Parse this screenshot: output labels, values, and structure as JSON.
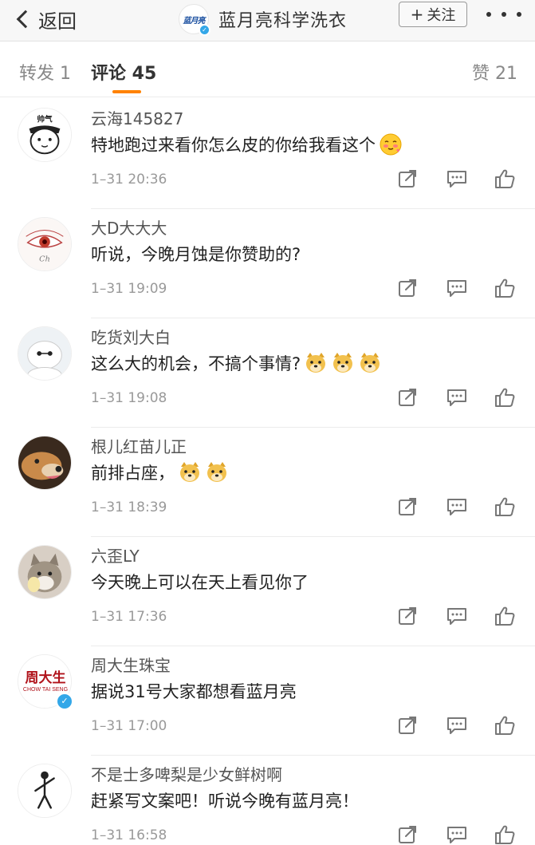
{
  "navbar": {
    "back_label": "返回",
    "logo_text": "蓝月亮",
    "account_name": "蓝月亮科学洗衣",
    "follow_label": "关注",
    "follow_plus": "+"
  },
  "tabs": {
    "repost": "转发 1",
    "comments": "评论 45",
    "likes": "赞 21"
  },
  "comments": [
    {
      "name": "云海145827",
      "text": "特地跑过来看你怎么皮的你给我看这个",
      "time": "1–31 20:36",
      "avatar": "face-cartoon-icon",
      "emojis": [
        "blushing-face-emoji"
      ]
    },
    {
      "name": "大D大大大",
      "text": "听说，今晚月蚀是你赞助的?",
      "time": "1–31 19:09",
      "avatar": "eye-sketch-icon",
      "emojis": []
    },
    {
      "name": "吃货刘大白",
      "text": "这么大的机会，不搞个事情?",
      "time": "1–31 19:08",
      "avatar": "baymax-icon",
      "emojis": [
        "doge-emoji",
        "doge-emoji",
        "doge-emoji"
      ]
    },
    {
      "name": "根儿红苗儿正",
      "text": "前排占座，",
      "time": "1–31 18:39",
      "avatar": "dog-photo-icon",
      "emojis": [
        "doge-emoji",
        "doge-emoji"
      ]
    },
    {
      "name": "六歪LY",
      "text": "今天晚上可以在天上看见你了",
      "time": "1–31 17:36",
      "avatar": "cat-photo-icon",
      "emojis": []
    },
    {
      "name": "周大生珠宝",
      "text": "据说31号大家都想看蓝月亮",
      "time": "1–31 17:00",
      "avatar": "chow-tai-seng-logo",
      "logo_cn": "周大生",
      "logo_en": "CHOW TAI SENG",
      "verified": true,
      "emojis": []
    },
    {
      "name": "不是士多啤梨是少女鲜树啊",
      "text": "赶紧写文案吧！听说今晚有蓝月亮！",
      "time": "1–31 16:58",
      "avatar": "stick-figure-icon",
      "emojis": []
    }
  ],
  "colors": {
    "accent": "#ff8200",
    "verify_blue": "#33a7e8",
    "navbar_bg": "#f7f7f7"
  }
}
